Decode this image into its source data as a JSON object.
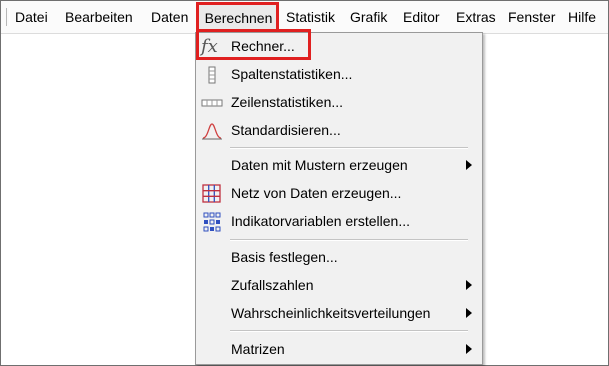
{
  "menubar": {
    "items": [
      {
        "label": "Datei"
      },
      {
        "label": "Bearbeiten"
      },
      {
        "label": "Daten"
      },
      {
        "label": "Berechnen"
      },
      {
        "label": "Statistik"
      },
      {
        "label": "Grafik"
      },
      {
        "label": "Editor"
      },
      {
        "label": "Extras"
      },
      {
        "label": "Fenster"
      },
      {
        "label": "Hilfe"
      }
    ],
    "active": "Berechnen"
  },
  "dropdown": {
    "items": [
      {
        "label": "Rechner...",
        "icon": "fx-icon",
        "highlighted": true
      },
      {
        "label": "Spaltenstatistiken...",
        "icon": "column-stats-icon"
      },
      {
        "label": "Zeilenstatistiken...",
        "icon": "row-stats-icon"
      },
      {
        "label": "Standardisieren...",
        "icon": "normal-curve-icon"
      },
      {
        "label": "Daten mit Mustern erzeugen",
        "submenu": true
      },
      {
        "label": "Netz von Daten erzeugen...",
        "icon": "grid-icon"
      },
      {
        "label": "Indikatorvariablen erstellen...",
        "icon": "indicator-variables-icon"
      },
      {
        "label": "Basis festlegen..."
      },
      {
        "label": "Zufallszahlen",
        "submenu": true
      },
      {
        "label": "Wahrscheinlichkeitsverteilungen",
        "submenu": true
      },
      {
        "label": "Matrizen",
        "submenu": true
      }
    ]
  },
  "icons": {
    "fx": "fx"
  },
  "colors": {
    "highlight_border": "#e02020",
    "menu_bg": "#f1f1f1",
    "menubar_bg": "#fbfbfb"
  }
}
